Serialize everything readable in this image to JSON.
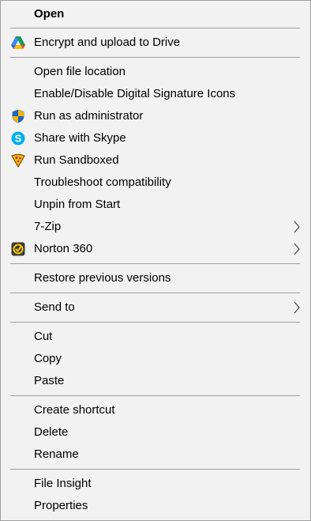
{
  "menu": {
    "items": [
      {
        "label": "Open"
      },
      {
        "label": "Encrypt and upload to Drive",
        "icon": "google-drive-icon"
      },
      {
        "label": "Open file location"
      },
      {
        "label": "Enable/Disable Digital Signature Icons"
      },
      {
        "label": "Run as administrator",
        "icon": "uac-shield-icon"
      },
      {
        "label": "Share with Skype",
        "icon": "skype-icon"
      },
      {
        "label": "Run Sandboxed",
        "icon": "sandboxie-icon"
      },
      {
        "label": "Troubleshoot compatibility"
      },
      {
        "label": "Unpin from Start"
      },
      {
        "label": "7-Zip",
        "submenu": true
      },
      {
        "label": "Norton 360",
        "icon": "norton-icon",
        "submenu": true
      },
      {
        "label": "Restore previous versions"
      },
      {
        "label": "Send to",
        "submenu": true
      },
      {
        "label": "Cut"
      },
      {
        "label": "Copy"
      },
      {
        "label": "Paste"
      },
      {
        "label": "Create shortcut"
      },
      {
        "label": "Delete"
      },
      {
        "label": "Rename"
      },
      {
        "label": "File Insight"
      },
      {
        "label": "Properties"
      }
    ]
  }
}
